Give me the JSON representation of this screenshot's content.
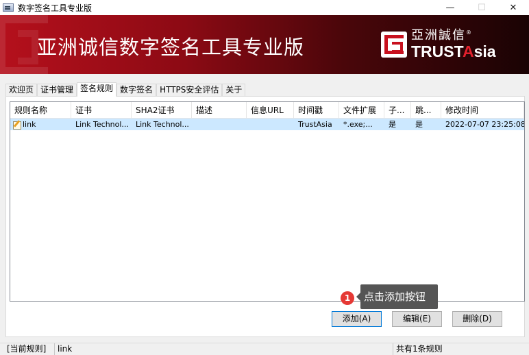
{
  "window": {
    "title": "数字签名工具专业版",
    "controls": {
      "minimize": "—",
      "maximize": "☐",
      "close": "✕"
    }
  },
  "banner": {
    "title": "亚洲诚信数字签名工具专业版",
    "logo": {
      "cn": "亞洲誠信",
      "en_main": "TRUST",
      "en_accent": "A",
      "en_rest": "sia",
      "registered": "®"
    }
  },
  "tabs": [
    {
      "label": "欢迎页",
      "active": false
    },
    {
      "label": "证书管理",
      "active": false
    },
    {
      "label": "签名规则",
      "active": true
    },
    {
      "label": "数字签名",
      "active": false
    },
    {
      "label": "HTTPS安全评估",
      "active": false
    },
    {
      "label": "关于",
      "active": false
    }
  ],
  "rules_table": {
    "columns": [
      "规则名称",
      "证书",
      "SHA2证书",
      "描述",
      "信息URL",
      "时间戳",
      "文件扩展",
      "子...",
      "跳...",
      "修改时间"
    ],
    "rows": [
      {
        "cells": [
          "link",
          "Link Technol...",
          "Link Technol...",
          "",
          "",
          "TrustAsia",
          "*.exe;...",
          "是",
          "是",
          "2022-07-07 23:25:08"
        ],
        "selected": true,
        "icon": "pencil-icon"
      }
    ]
  },
  "hint": {
    "step": "1",
    "text": "点击添加按钮"
  },
  "buttons": {
    "add": "添加(A)",
    "edit": "编辑(E)",
    "delete": "删除(D)"
  },
  "statusbar": {
    "label": "[当前规则]",
    "current_rule": "link",
    "count": "共有1条规则"
  },
  "colors": {
    "banner_red": "#b5101c",
    "selection": "#cce8ff",
    "badge": "#e53935",
    "tooltip": "#555555"
  }
}
